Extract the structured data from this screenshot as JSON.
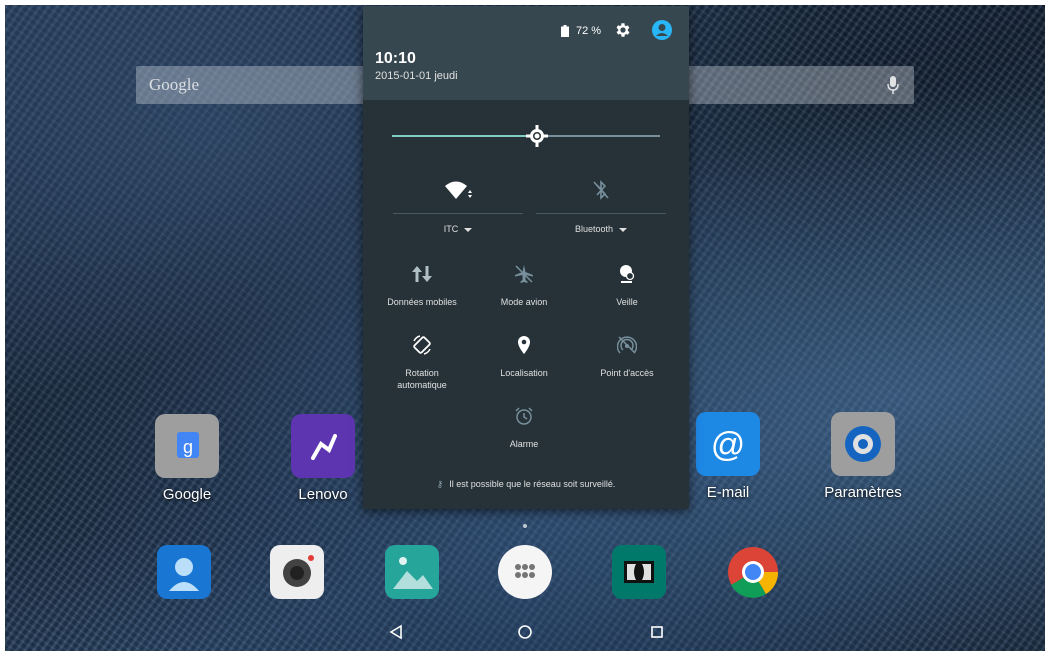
{
  "status": {
    "battery_percent": "72 %",
    "time": "10:10",
    "date": "2015-01-01 jeudi"
  },
  "brightness": {
    "level": 0.54
  },
  "search": {
    "logo": "Google"
  },
  "quick_settings": {
    "wifi": {
      "label": "ITC",
      "icon": "wifi-icon"
    },
    "bluetooth": {
      "label": "Bluetooth",
      "icon": "bluetooth-off-icon"
    },
    "tiles": [
      {
        "label": "Données mobiles",
        "icon": "mobile-data-icon"
      },
      {
        "label": "Mode avion",
        "icon": "airplane-icon"
      },
      {
        "label": "Veille",
        "icon": "stay-awake-icon"
      },
      {
        "label": "Rotation\nautomatique",
        "icon": "auto-rotate-icon"
      },
      {
        "label": "Localisation",
        "icon": "location-icon"
      },
      {
        "label": "Point d'accès",
        "icon": "hotspot-icon"
      },
      {
        "label": "Alarme",
        "icon": "alarm-icon"
      }
    ],
    "notice": "Il est possible que le réseau soit surveillé."
  },
  "home_apps": [
    {
      "label": "Google",
      "color": "#9e9e9e"
    },
    {
      "label": "Lenovo",
      "color": "#5e35b1"
    },
    {
      "label": "E-mail",
      "color": "#1e88e5"
    },
    {
      "label": "Paramètres",
      "color": "#9e9e9e"
    }
  ],
  "dock": [
    {
      "icon": "contacts-icon",
      "color": "#1976d2"
    },
    {
      "icon": "camera-icon",
      "color": "#eeeeee"
    },
    {
      "icon": "gallery-icon",
      "color": "#26a69a"
    },
    {
      "icon": "app-drawer-icon",
      "color": "#f5f5f5"
    },
    {
      "icon": "dolby-icon",
      "color": "#00796b"
    },
    {
      "icon": "chrome-icon",
      "color": "#ffffff"
    }
  ],
  "colors": {
    "accent": "#80cbc4",
    "panel": "#263238",
    "panel_header": "#37474f",
    "avatar": "#29b6f6"
  }
}
